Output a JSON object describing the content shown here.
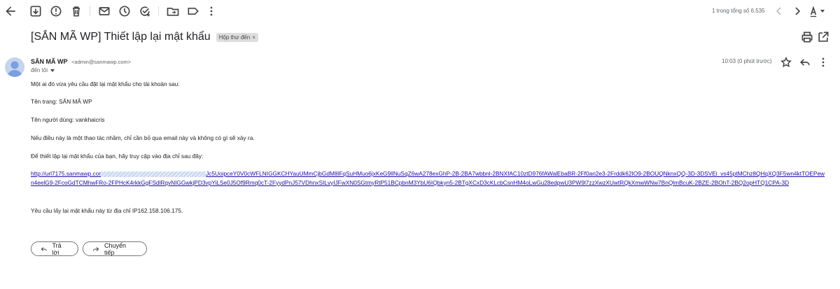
{
  "toolbar": {
    "pagination": "1 trong tổng số 6.535"
  },
  "email": {
    "subject": "[SẮN MÃ WP] Thiết lập lại mật khẩu",
    "label": "Hộp thư đến",
    "sender_name": "SĂN MÃ WP",
    "sender_email": "<admin@sanmawp.com>",
    "to": "đến tôi",
    "time": "10:03 (0 phút trước)",
    "body": {
      "p1": "Một ai đó vừa yêu cầu đặt lại mật khẩu cho tài khoản sau:",
      "p2": "Tên trang: SĂN MÃ WP",
      "p3": "Tên người dùng: vankhaicris",
      "p4": "Nếu điều này là một thao tác nhầm, chỉ cần bỏ qua email này và không có gì sẽ xảy ra.",
      "p5": "Để thiết lập lại mật khẩu của bạn, hãy truy cập vào địa chỉ sau đây:",
      "link_start": "http://url7175.sanmawp.cor",
      "link_rest": "Jc5UoipceY0V0cWFLNIGGKCHYauUMmCjbGdM8lFqSuHMuo6jxKeG9llNuSqZ6wA278exGhP-2B-2BA7wbbnl-2BNXfAC10ztD976fAWalEbaBR-2Ff0an2e3-2Frddk62IO9-2BOUQNknxQQ-3D-3DSVEi_vs45ptMChz8QHqXQ3F5wn4ktTOEPewn4eelG9-2FcoGdTCMhwFRo-2FPHcK4rkkGgFSdlRqvNIGGwkjPD3vpYiLSe0J5Of9Rmq0cT-2FyydPnJ57VDhnxSILvyIJFwXN0SGtmyRtP51BCpbnM3YbU6IQbkyn5-2BTgXCxD3cKLcbCsnHM4oLwGu28edpwU3PW9l7zzXwzXUwtRQkXmwWNw7BnQlmBcuK-2BZE-2BOhT-2BQ2opHTQ1CPA-3D",
      "p6": "Yêu cầu lấy lại mật khẩu này từ địa chỉ IP162.158.106.175."
    }
  },
  "actions": {
    "reply": "Trả lời",
    "forward": "Chuyển tiếp"
  }
}
